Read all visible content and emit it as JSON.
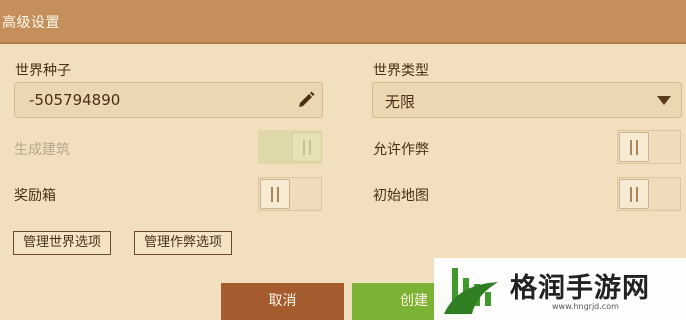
{
  "window": {
    "title": "高级设置"
  },
  "seed": {
    "label": "世界种子",
    "value": "-505794890"
  },
  "world_type": {
    "label": "世界类型",
    "selected": "无限"
  },
  "toggles": {
    "generate_structures": {
      "label": "生成建筑",
      "enabled": false
    },
    "bonus_chest": {
      "label": "奖励箱",
      "enabled": true
    },
    "allow_cheats": {
      "label": "允许作弊",
      "enabled": true
    },
    "starting_map": {
      "label": "初始地图",
      "enabled": true
    }
  },
  "buttons": {
    "manage_world": "管理世界选项",
    "manage_cheats": "管理作弊选项",
    "cancel": "取消",
    "create": "创建"
  },
  "watermark": {
    "text": "格润手游网",
    "url": "www.hngrjd.com"
  },
  "icons": {
    "edit": "pencil-icon",
    "dropdown": "triangle-down-icon",
    "logo": "leaf-chart-logo-icon"
  },
  "colors": {
    "title_bar": "#c58f5b",
    "background": "#f1dfbd",
    "cancel": "#a55b2e",
    "create": "#7db335",
    "logo_green": "#3f9a2d"
  }
}
